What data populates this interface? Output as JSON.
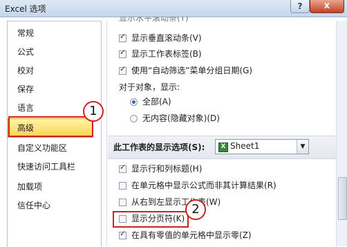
{
  "window": {
    "title": "Excel 选项",
    "help_label": "?",
    "close_label": "x"
  },
  "sidebar": {
    "items": [
      {
        "label": "常规"
      },
      {
        "label": "公式"
      },
      {
        "label": "校对"
      },
      {
        "label": "保存"
      },
      {
        "label": "语言"
      },
      {
        "label": "高级",
        "active": true
      },
      {
        "label": "自定义功能区"
      },
      {
        "label": "快速访问工具栏"
      },
      {
        "label": "加载项"
      },
      {
        "label": "信任中心"
      }
    ]
  },
  "workbook_options": {
    "top_partial": "显示水平滚动条(T)",
    "vertical_scroll": {
      "label": "显示垂直滚动条(V)",
      "checked": true
    },
    "sheet_tabs": {
      "label": "显示工作表标签(B)",
      "checked": true
    },
    "autofilter_dates": {
      "label": "使用“自动筛选”菜单分组日期(G)",
      "checked": true
    },
    "objects_heading": "对于对象，显示:",
    "objects_all": {
      "label": "全部(A)",
      "selected": true
    },
    "objects_none": {
      "label": "无内容(隐藏对象)(D)",
      "selected": false
    }
  },
  "sheet_section": {
    "label": "此工作表的显示选项(S):",
    "sheet_select": {
      "value": "Sheet1",
      "icon": "excel-sheet-icon"
    }
  },
  "sheet_options": [
    {
      "label": "显示行和列标题(H)",
      "checked": true
    },
    {
      "label": "在单元格中显示公式而非其计算结果(R)",
      "checked": false
    },
    {
      "label": "从右到左显示工作表(W)",
      "checked": false
    },
    {
      "label": "显示分页符(K)",
      "checked": false
    },
    {
      "label": "在具有零值的单元格中显示零(Z)",
      "checked": true
    }
  ],
  "callouts": {
    "one": "1",
    "two": "2",
    "color": "#cc2222"
  }
}
